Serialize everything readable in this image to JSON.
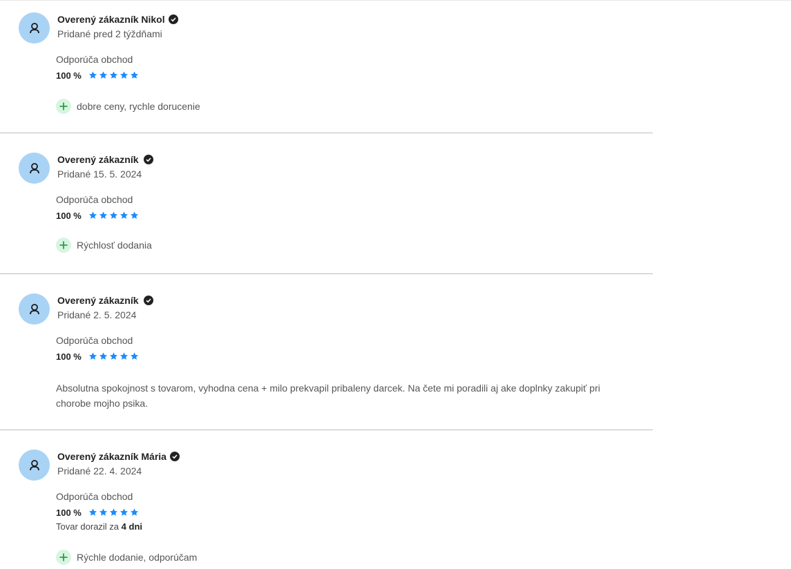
{
  "reviews": [
    {
      "author": "Overený zákazník Nikol",
      "date": "Pridané pred 2 týždňami",
      "recommend_label": "Odporúča obchod",
      "rating_percent": "100 %",
      "stars": 5,
      "pros": [
        "dobre ceny, rychle dorucenie"
      ],
      "text": "",
      "delivery_prefix": "",
      "delivery_value": ""
    },
    {
      "author": "Overený zákazník",
      "date": "Pridané 15. 5. 2024",
      "recommend_label": "Odporúča obchod",
      "rating_percent": "100 %",
      "stars": 5,
      "pros": [
        "Rýchlosť dodania"
      ],
      "text": "",
      "delivery_prefix": "",
      "delivery_value": ""
    },
    {
      "author": "Overený zákazník",
      "date": "Pridané 2. 5. 2024",
      "recommend_label": "Odporúča obchod",
      "rating_percent": "100 %",
      "stars": 5,
      "pros": [],
      "text": "Absolutna spokojnost s tovarom, vyhodna cena + milo prekvapil pribaleny darcek. Na čete mi poradili aj ake doplnky zakupiť pri chorobe mojho psika.",
      "delivery_prefix": "",
      "delivery_value": ""
    },
    {
      "author": "Overený zákazník Mária",
      "date": "Pridané 22. 4. 2024",
      "recommend_label": "Odporúča obchod",
      "rating_percent": "100 %",
      "stars": 5,
      "pros": [
        "Rýchle dodanie, odporúčam"
      ],
      "text": "",
      "delivery_prefix": "Tovar dorazil za",
      "delivery_value": "4 dni"
    }
  ],
  "icons": {
    "avatar": "user-icon",
    "verified": "check-circle-icon",
    "star": "star-icon",
    "pro": "plus-icon"
  },
  "colors": {
    "avatar_bg": "#a9d3f5",
    "star": "#1a8cff",
    "plus_bg": "#d7f5df",
    "plus_fg": "#2e9b4a",
    "divider": "#bdbdbd"
  }
}
